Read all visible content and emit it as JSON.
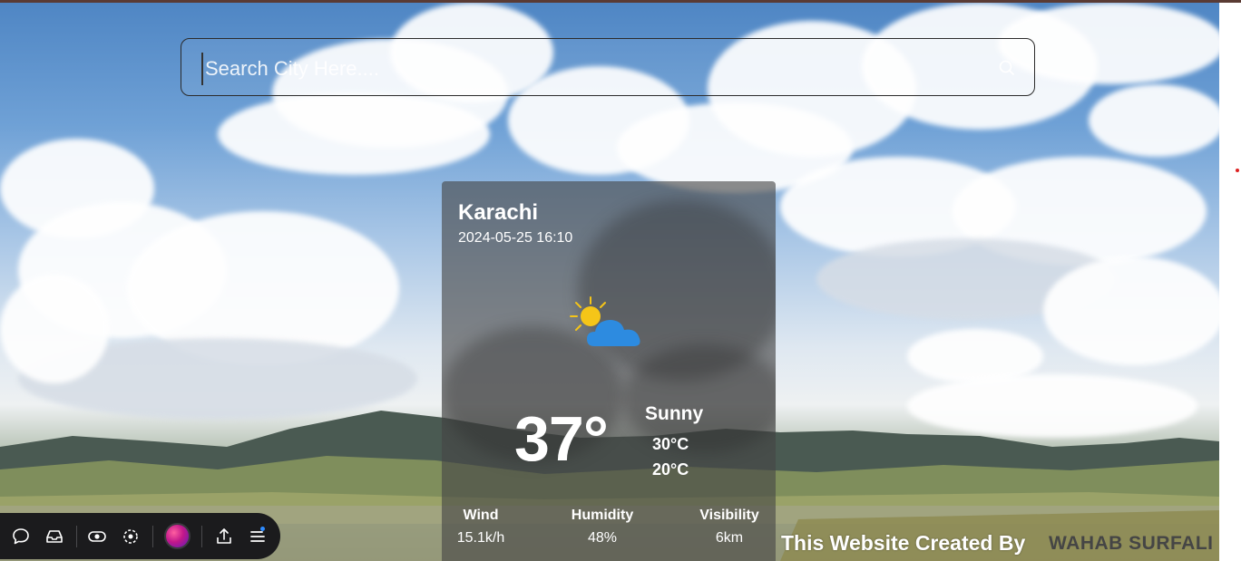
{
  "search": {
    "placeholder": "Search City Here...."
  },
  "weather": {
    "city": "Karachi",
    "datetime": "2024-05-25 16:10",
    "temperature": "37°",
    "condition": "Sunny",
    "max_temp": "30°C",
    "min_temp": "20°C",
    "stats": [
      {
        "label": "Wind",
        "value": "15.1k/h"
      },
      {
        "label": "Humidity",
        "value": "48%"
      },
      {
        "label": "Visibility",
        "value": "6km"
      }
    ],
    "icon": "sun-behind-cloud-icon"
  },
  "footer": {
    "credit_text": "This Website Created By",
    "author": "WAHAB SURFALI"
  },
  "dock": {
    "icons": [
      "chat-icon",
      "inbox-icon",
      "eye-toggle-icon",
      "focus-icon",
      "avatar",
      "share-icon",
      "menu-icon"
    ]
  },
  "colors": {
    "card_bg": "#464646",
    "sun": "#f5c518",
    "cloud": "#2d8be0",
    "dock_bg": "#1b1b1d",
    "notification": "#2e8bff"
  }
}
